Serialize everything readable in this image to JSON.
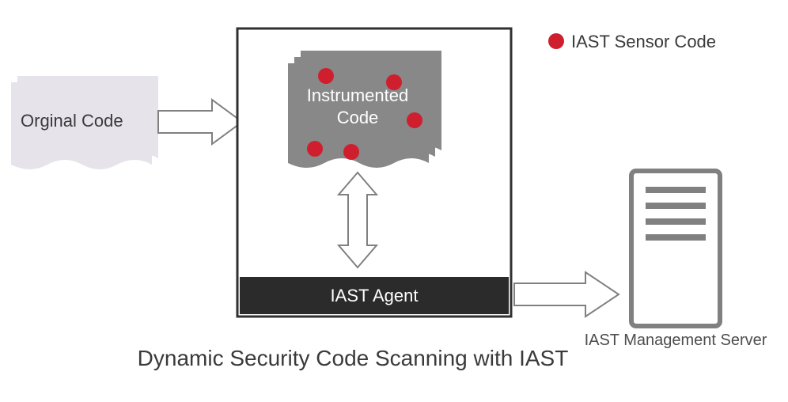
{
  "diagram": {
    "caption": "Dynamic Security Code Scanning with IAST",
    "original_code_label": "Orginal Code",
    "instrumented_code_label_line1": "Instrumented",
    "instrumented_code_label_line2": "Code",
    "agent_label": "IAST Agent",
    "legend_label": "IAST Sensor Code",
    "server_label": "IAST Management Server",
    "colors": {
      "sensor_dot": "#cf1f2e",
      "original_code_bg": "#e6e3ea",
      "container_border": "#303030",
      "instrumented_bg": "#888888",
      "agent_bg": "#2b2b2b",
      "arrow_stroke": "#808080",
      "server_stroke": "#808080"
    }
  }
}
